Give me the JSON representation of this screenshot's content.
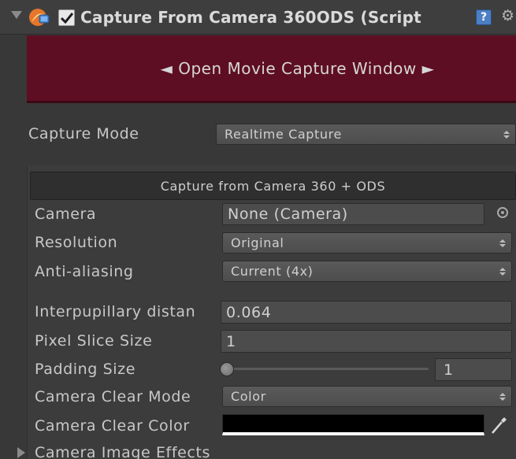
{
  "header": {
    "title": "Capture From Camera 360ODS (Script",
    "enabled": true,
    "icons": [
      "foldout-arrow-icon",
      "script-icon",
      "help-icon",
      "gear-icon"
    ]
  },
  "movie_capture_button": {
    "label": "◄ Open Movie Capture Window ►"
  },
  "capture_mode": {
    "label": "Capture Mode",
    "value": "Realtime Capture"
  },
  "section": {
    "title": "Capture from Camera 360 + ODS",
    "fields": {
      "camera": {
        "label": "Camera",
        "value": "None (Camera)"
      },
      "resolution": {
        "label": "Resolution",
        "value": "Original"
      },
      "anti_aliasing": {
        "label": "Anti-aliasing",
        "value": "Current (4x)"
      },
      "interpupillary": {
        "label": "Interpupillary distan",
        "value": "0.064"
      },
      "pixel_slice": {
        "label": "Pixel Slice Size",
        "value": "1"
      },
      "padding": {
        "label": "Padding Size",
        "value": "1",
        "slider_fraction": 0.0
      },
      "clear_mode": {
        "label": "Camera Clear Mode",
        "value": "Color"
      },
      "clear_color": {
        "label": "Camera Clear Color",
        "color": "#000000"
      }
    },
    "foldout": {
      "label": "Camera Image Effects"
    }
  },
  "colors": {
    "background": "#383838",
    "movie_button": "#5e0e22",
    "help_icon": "#4c7fc4"
  }
}
